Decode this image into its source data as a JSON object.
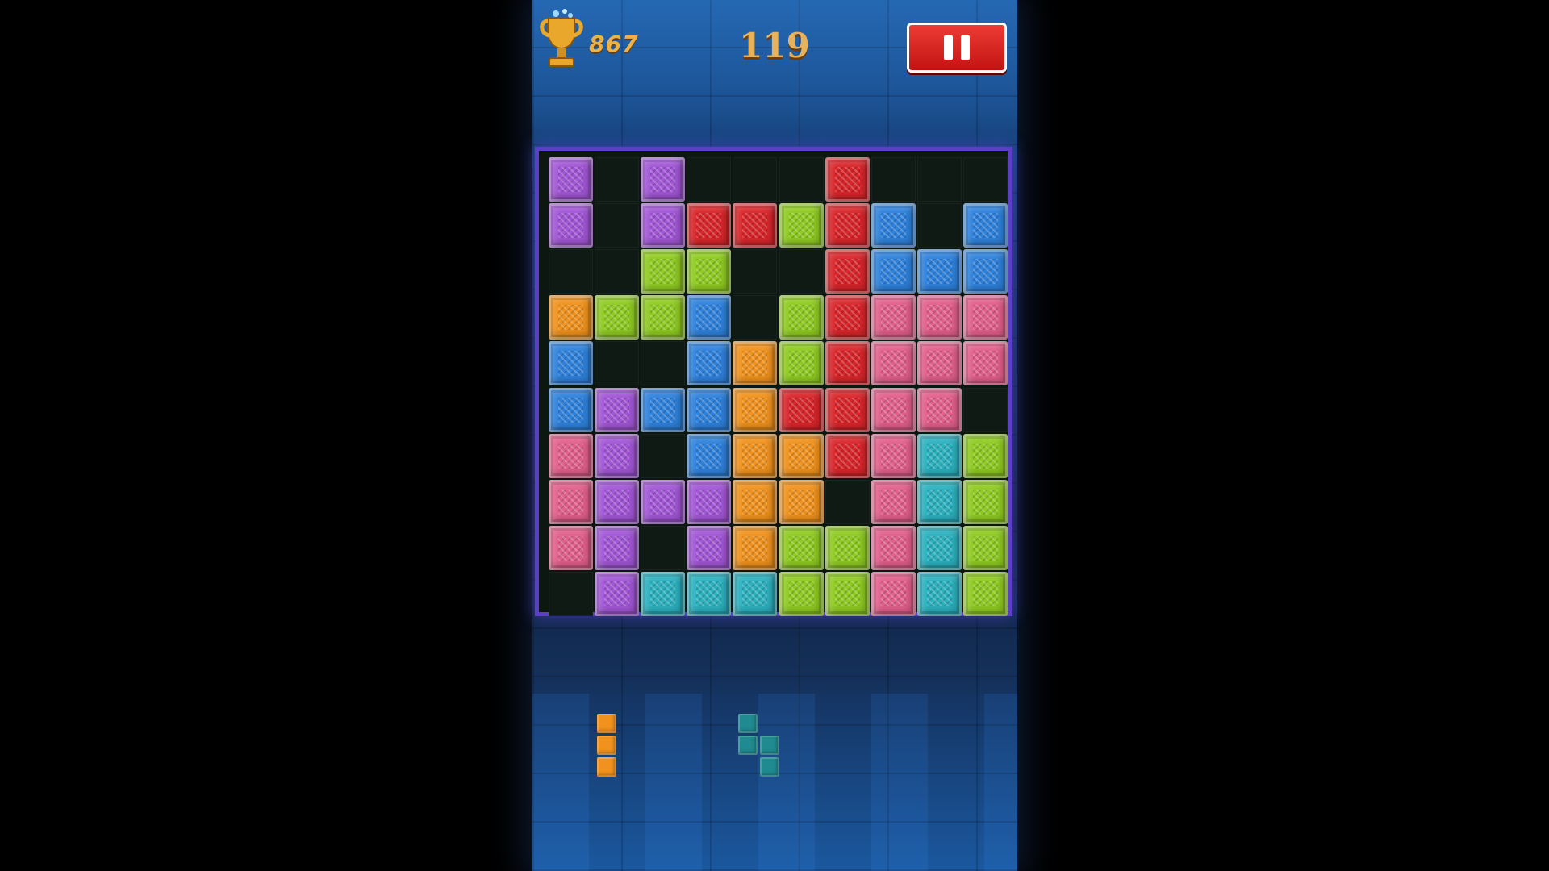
{
  "hud": {
    "best_score": "867",
    "score": "119",
    "pause_label": "pause"
  },
  "colors": {
    "purple": "#a257d6",
    "red": "#d9262b",
    "green": "#8fcb22",
    "blue": "#2f82dc",
    "orange": "#f0921d",
    "pink": "#e2608c",
    "teal": "#2cb1bf"
  },
  "board": {
    "rows": 10,
    "cols": 10,
    "cells": [
      [
        "purple",
        null,
        "purple",
        null,
        null,
        null,
        "red",
        null,
        null,
        null
      ],
      [
        "purple",
        null,
        "purple",
        "red",
        "red",
        "green",
        "red",
        "blue",
        null,
        "blue"
      ],
      [
        null,
        null,
        "green",
        "green",
        null,
        null,
        "red",
        "blue",
        "blue",
        "blue"
      ],
      [
        "orange",
        "green",
        "green",
        "blue",
        null,
        "green",
        "red",
        "pink",
        "pink",
        "pink"
      ],
      [
        "blue",
        null,
        null,
        "blue",
        "orange",
        "green",
        "red",
        "pink",
        "pink",
        "pink"
      ],
      [
        "blue",
        "purple",
        "blue",
        "blue",
        "orange",
        "red",
        "red",
        "pink",
        "pink",
        null
      ],
      [
        "pink",
        "purple",
        null,
        "blue",
        "orange",
        "orange",
        "red",
        "pink",
        "teal",
        "green"
      ],
      [
        "pink",
        "purple",
        "purple",
        "purple",
        "orange",
        "orange",
        null,
        "pink",
        "teal",
        "green"
      ],
      [
        "pink",
        "purple",
        null,
        "purple",
        "orange",
        "green",
        "green",
        "pink",
        "teal",
        "green"
      ],
      [
        null,
        "purple",
        "teal",
        "teal",
        "teal",
        "green",
        "green",
        "pink",
        "teal",
        "green"
      ]
    ]
  },
  "tray": {
    "pieces": [
      {
        "name": "vertical-three",
        "color": "#f0921d",
        "blocks": [
          [
            0,
            0
          ],
          [
            0,
            1
          ],
          [
            0,
            2
          ]
        ]
      },
      {
        "name": "s-shape",
        "color": "#1f8a8f",
        "blocks": [
          [
            0,
            0
          ],
          [
            0,
            1
          ],
          [
            1,
            1
          ],
          [
            1,
            2
          ]
        ]
      }
    ]
  }
}
